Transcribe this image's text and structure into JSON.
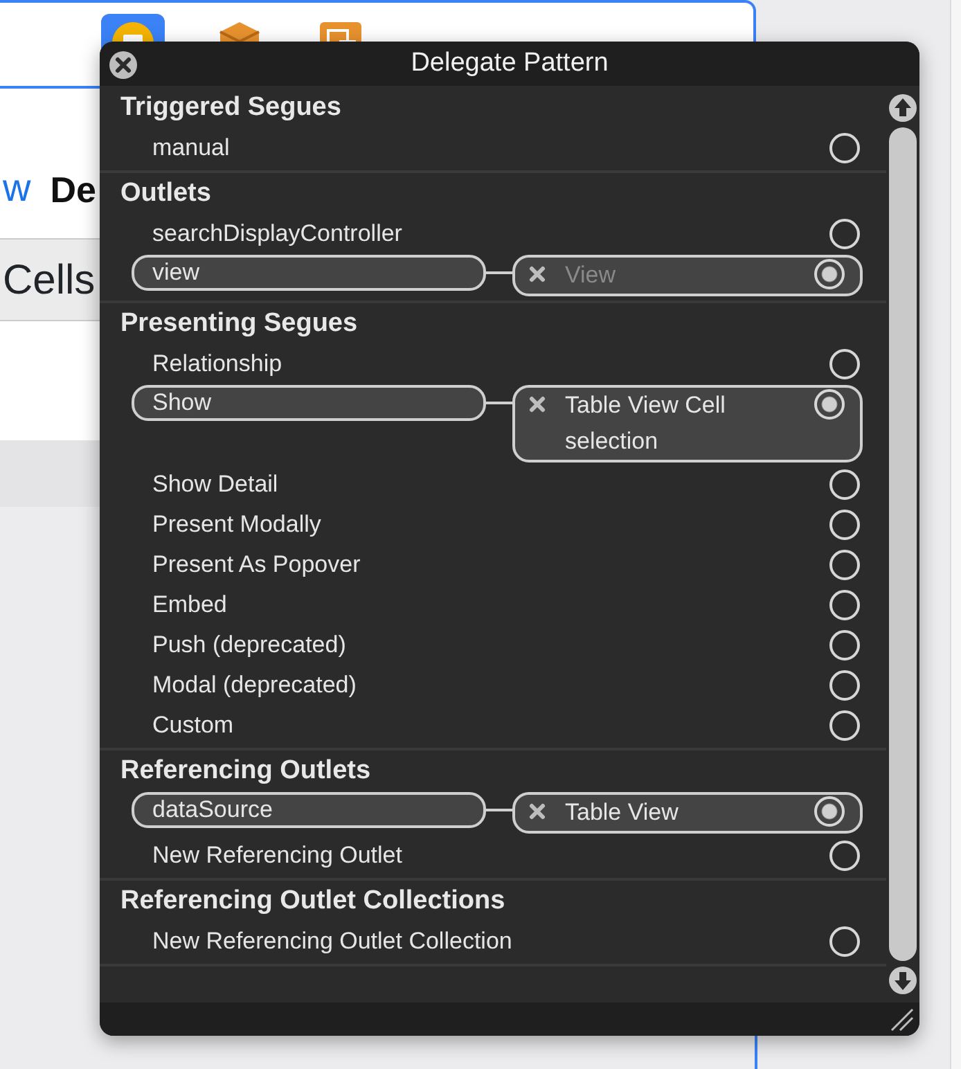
{
  "scene": {
    "back_label": "w",
    "title": "De",
    "cell_label": "Cells",
    "tools": [
      {
        "kind": "controller",
        "selected": true
      },
      {
        "kind": "cube",
        "selected": false
      },
      {
        "kind": "exit",
        "selected": false
      }
    ]
  },
  "panel": {
    "title": "Delegate Pattern",
    "sections": [
      {
        "title": "Triggered Segues",
        "items": [
          {
            "label": "manual",
            "connected": false
          }
        ]
      },
      {
        "title": "Outlets",
        "items": [
          {
            "label": "searchDisplayController",
            "connected": false
          },
          {
            "label": "view",
            "connected": true,
            "target": {
              "label": "View",
              "disabled": true
            }
          }
        ]
      },
      {
        "title": "Presenting Segues",
        "items": [
          {
            "label": "Relationship",
            "connected": false
          },
          {
            "label": "Show",
            "connected": true,
            "target": {
              "label": "Table View Cell selection",
              "disabled": false
            }
          },
          {
            "label": "Show Detail",
            "connected": false
          },
          {
            "label": "Present Modally",
            "connected": false
          },
          {
            "label": "Present As Popover",
            "connected": false
          },
          {
            "label": "Embed",
            "connected": false
          },
          {
            "label": "Push (deprecated)",
            "connected": false
          },
          {
            "label": "Modal (deprecated)",
            "connected": false
          },
          {
            "label": "Custom",
            "connected": false
          }
        ]
      },
      {
        "title": "Referencing Outlets",
        "items": [
          {
            "label": "dataSource",
            "connected": true,
            "target": {
              "label": "Table View",
              "disabled": false
            }
          },
          {
            "label": "New Referencing Outlet",
            "connected": false
          }
        ]
      },
      {
        "title": "Referencing Outlet Collections",
        "items": [
          {
            "label": "New Referencing Outlet Collection",
            "connected": false
          }
        ]
      }
    ]
  }
}
